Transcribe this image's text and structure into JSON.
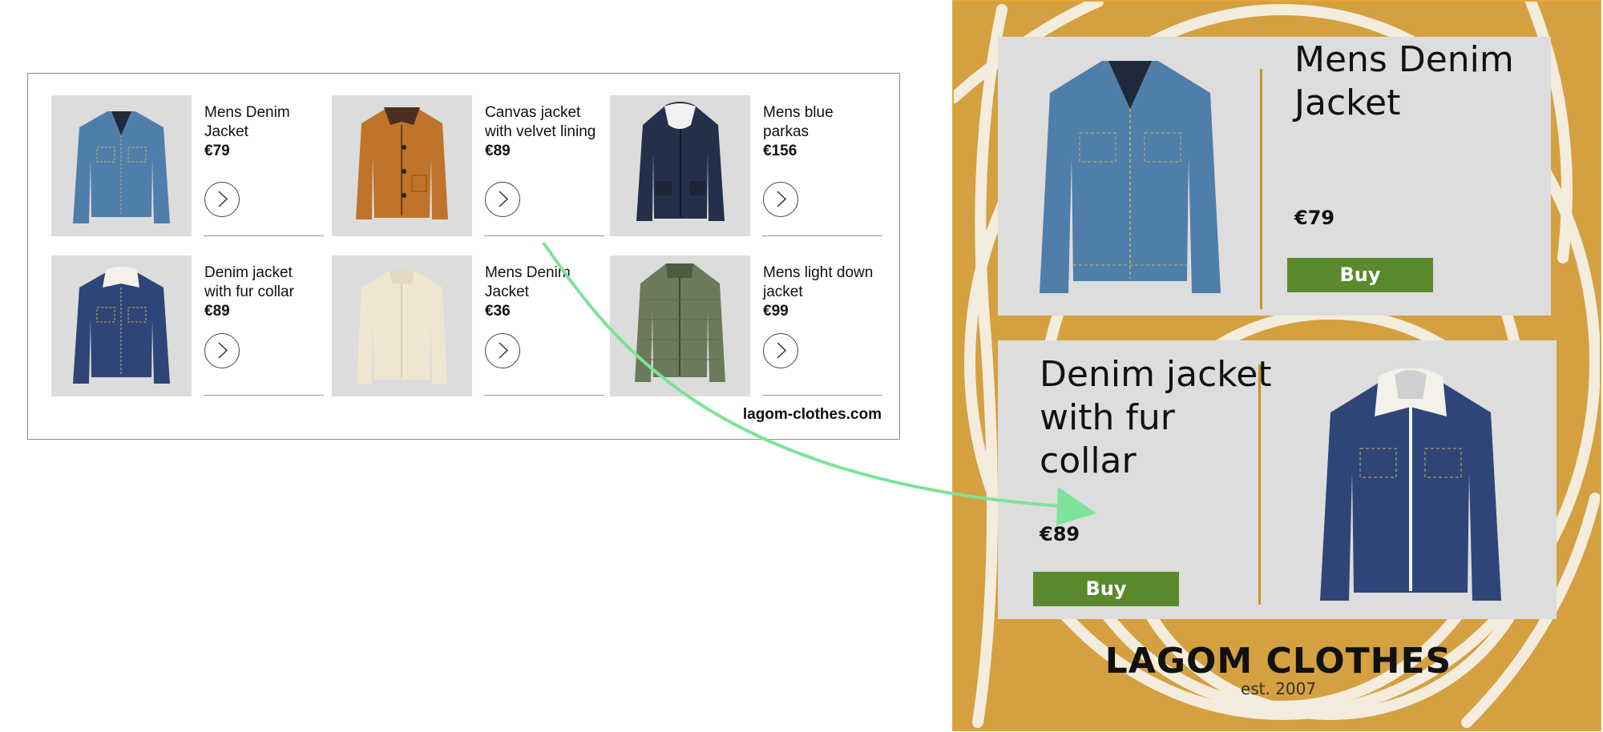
{
  "catalog": {
    "products": [
      {
        "name": "Mens Denim Jacket",
        "price": "€79",
        "image": "denim-jacket",
        "color": "#4f7eaa"
      },
      {
        "name": "Canvas jacket with velvet lining",
        "price": "€89",
        "image": "canvas-jacket",
        "color": "#c0732a"
      },
      {
        "name": "Mens blue parkas",
        "price": "€156",
        "image": "parka",
        "color": "#24304a"
      },
      {
        "name": "Denim jacket with fur collar",
        "price": "€89",
        "image": "fur-collar-jacket",
        "color": "#2f4577"
      },
      {
        "name": "Mens Denim Jacket",
        "price": "€36",
        "image": "cream-jacket",
        "color": "#efe6d2"
      },
      {
        "name": "Mens light down jacket",
        "price": "€99",
        "image": "down-jacket",
        "color": "#6b7a5a"
      }
    ],
    "site_url": "lagom-clothes.com"
  },
  "ad": {
    "background": "#d4a040",
    "panels": [
      {
        "name": "Mens Denim Jacket",
        "price": "€79",
        "buy_label": "Buy"
      },
      {
        "name": "Denim jacket with fur collar",
        "price": "€89",
        "buy_label": "Buy"
      }
    ],
    "brand": "LAGOM CLOTHES",
    "tagline": "est. 2007"
  },
  "colors": {
    "accent_green": "#5a8a2b",
    "arrow": "#7de39a",
    "panel_bg": "#dddddd"
  }
}
